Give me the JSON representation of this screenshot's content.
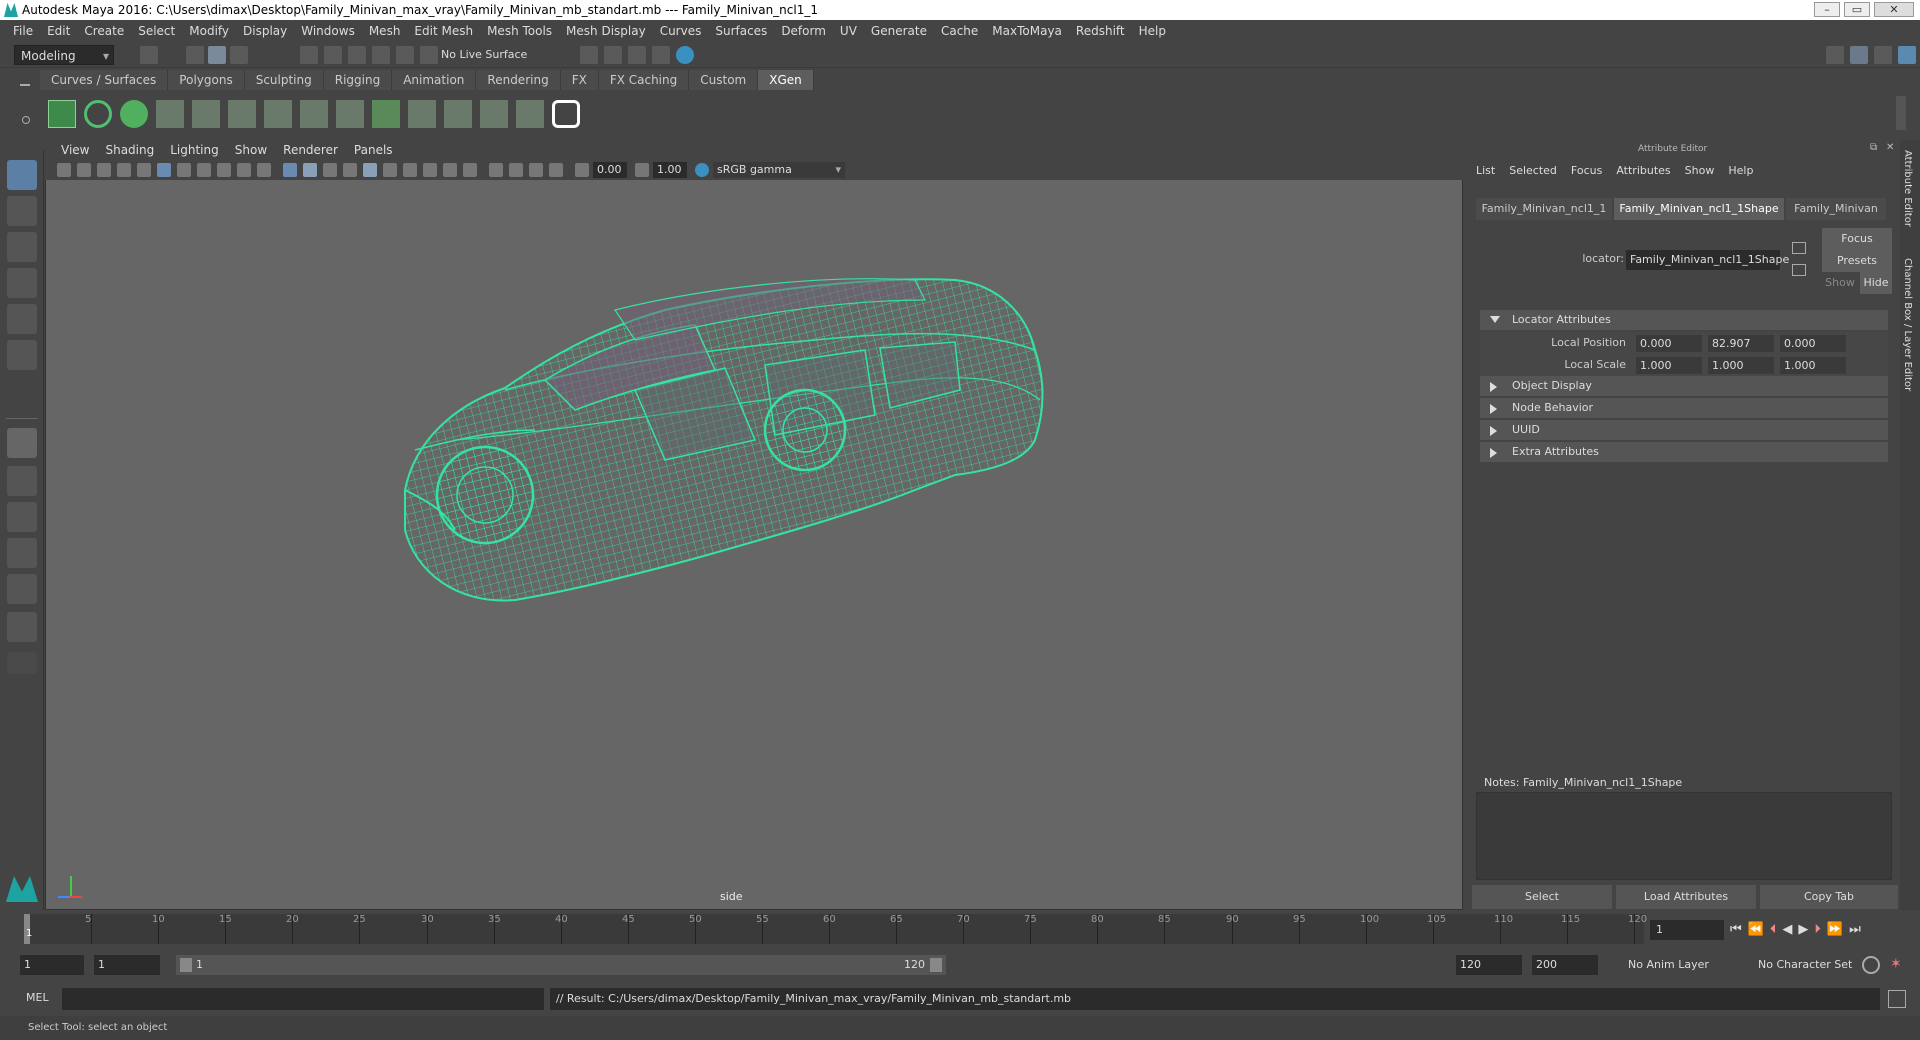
{
  "window": {
    "title": "Autodesk Maya 2016: C:\\Users\\dimax\\Desktop\\Family_Minivan_max_vray\\Family_Minivan_mb_standart.mb   ---   Family_Minivan_ncl1_1"
  },
  "menubar": [
    "File",
    "Edit",
    "Create",
    "Select",
    "Modify",
    "Display",
    "Windows",
    "Mesh",
    "Edit Mesh",
    "Mesh Tools",
    "Mesh Display",
    "Curves",
    "Surfaces",
    "Deform",
    "UV",
    "Generate",
    "Cache",
    "MaxToMaya",
    "Redshift",
    "Help"
  ],
  "statusline": {
    "mode": "Modeling",
    "live_surface": "No Live Surface"
  },
  "shelf_tabs": [
    "Curves / Surfaces",
    "Polygons",
    "Sculpting",
    "Rigging",
    "Animation",
    "Rendering",
    "FX",
    "FX Caching",
    "Custom",
    "XGen"
  ],
  "shelf_active": "XGen",
  "viewport": {
    "menu": [
      "View",
      "Shading",
      "Lighting",
      "Show",
      "Renderer",
      "Panels"
    ],
    "exposure": "0.00",
    "gamma": "1.00",
    "color_space": "sRGB gamma",
    "camera_label": "side",
    "wire_color": "#35e3a0"
  },
  "attribute_editor": {
    "title": "Attribute Editor",
    "menu": [
      "List",
      "Selected",
      "Focus",
      "Attributes",
      "Show",
      "Help"
    ],
    "tabs": [
      "Family_Minivan_ncl1_1",
      "Family_Minivan_ncl1_1Shape",
      "Family_Minivan"
    ],
    "active_tab": "Family_Minivan_ncl1_1Shape",
    "node_label": "locator:",
    "node_value": "Family_Minivan_ncl1_1Shape",
    "focus_btn": "Focus",
    "presets_btn": "Presets",
    "show_btn": "Show",
    "hide_btn": "Hide",
    "sections": {
      "locator": "Locator Attributes",
      "object_display": "Object Display",
      "node_behavior": "Node Behavior",
      "uuid": "UUID",
      "extra": "Extra Attributes"
    },
    "local_position_label": "Local Position",
    "local_position": [
      "0.000",
      "82.907",
      "0.000"
    ],
    "local_scale_label": "Local Scale",
    "local_scale": [
      "1.000",
      "1.000",
      "1.000"
    ],
    "notes_label": "Notes:  Family_Minivan_ncl1_1Shape",
    "buttons": {
      "select": "Select",
      "load": "Load Attributes",
      "copy": "Copy Tab"
    }
  },
  "side_tabs": [
    "Attribute Editor",
    "Channel Box / Layer Editor"
  ],
  "timeline": {
    "ticks": [
      "5",
      "10",
      "15",
      "20",
      "25",
      "30",
      "35",
      "40",
      "45",
      "50",
      "55",
      "60",
      "65",
      "70",
      "75",
      "80",
      "85",
      "90",
      "95",
      "100",
      "105",
      "110",
      "115",
      "120"
    ],
    "current_frame_marker": "1",
    "current_frame": "1"
  },
  "range": {
    "start": "1",
    "start_inner": "1",
    "slider_start": "1",
    "slider_end": "120",
    "end_inner": "120",
    "end": "200",
    "anim_layer": "No Anim Layer",
    "char_set": "No Character Set"
  },
  "cmdline": {
    "lang": "MEL",
    "result": "// Result: C:/Users/dimax/Desktop/Family_Minivan_max_vray/Family_Minivan_mb_standart.mb"
  },
  "helpline": "Select Tool: select an object"
}
